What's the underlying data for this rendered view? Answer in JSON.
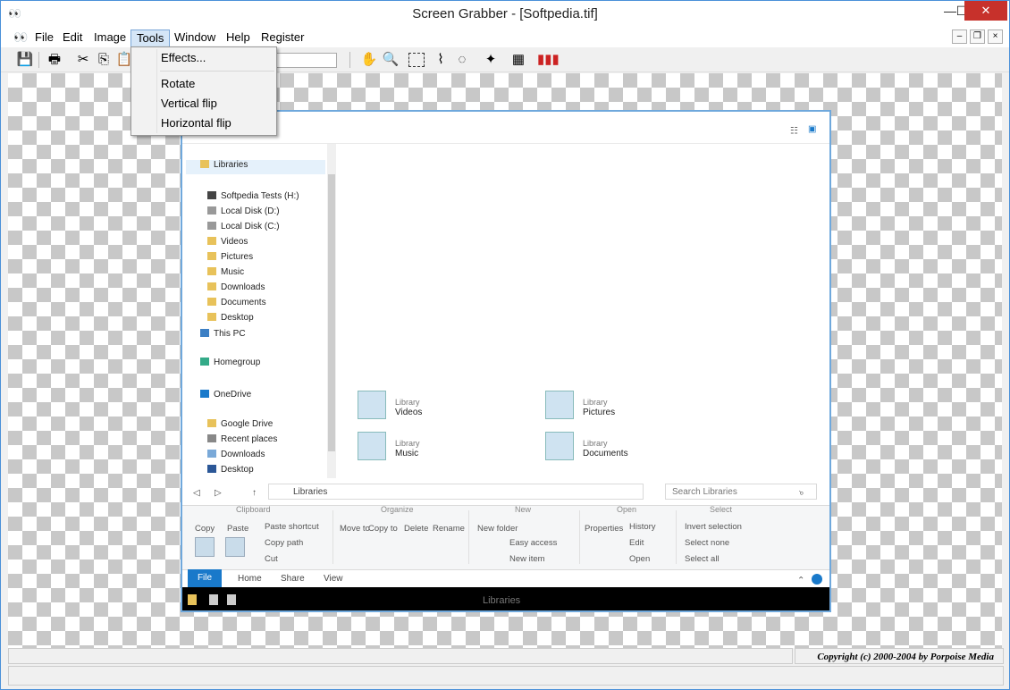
{
  "window": {
    "title": "Screen Grabber - [Softpedia.tif]",
    "app_icon": "binoculars-icon"
  },
  "menubar": {
    "items": [
      "File",
      "Edit",
      "Image",
      "Tools",
      "Window",
      "Help",
      "Register"
    ],
    "active": "Tools"
  },
  "tools_menu": {
    "items": [
      "Effects...",
      "Rotate",
      "Vertical flip",
      "Horizontal flip"
    ]
  },
  "toolbar": {
    "icons": [
      "save-icon",
      "print-icon",
      "cut-icon",
      "copy-icon",
      "paste-icon",
      "hand-icon",
      "zoom-icon",
      "rect-select-icon",
      "lasso-icon",
      "ellipse-select-icon",
      "magic-wand-icon",
      "filter-icon",
      "colors-icon"
    ]
  },
  "explorer": {
    "taskbar_title": "Libraries",
    "tabs": [
      "File",
      "Home",
      "Share",
      "View"
    ],
    "ribbon": {
      "groups": [
        "Clipboard",
        "Organize",
        "New",
        "Open",
        "Select"
      ],
      "labels": [
        "Copy",
        "Paste",
        "Paste shortcut",
        "Copy path",
        "Cut",
        "Move to",
        "Copy to",
        "Delete",
        "Rename",
        "New folder",
        "Easy access",
        "New item",
        "Properties",
        "History",
        "Edit",
        "Open",
        "Invert selection",
        "Select none",
        "Select all"
      ]
    },
    "address": "Libraries",
    "search_placeholder": "Search Libraries",
    "nav_items": [
      "Libraries",
      "Softpedia Tests (H:)",
      "Local Disk (D:)",
      "Local Disk (C:)",
      "Videos",
      "Pictures",
      "Music",
      "Downloads",
      "Documents",
      "Desktop",
      "This PC",
      "Homegroup",
      "OneDrive",
      "Google Drive",
      "Recent places",
      "Downloads",
      "Desktop"
    ],
    "libraries": [
      {
        "sub": "Library",
        "name": "Pictures"
      },
      {
        "sub": "Library",
        "name": "Videos"
      },
      {
        "sub": "Library",
        "name": "Documents"
      },
      {
        "sub": "Library",
        "name": "Music"
      }
    ]
  },
  "status": {
    "copyright": "Copyright (c) 2000-2004 by Porpoise Media"
  }
}
